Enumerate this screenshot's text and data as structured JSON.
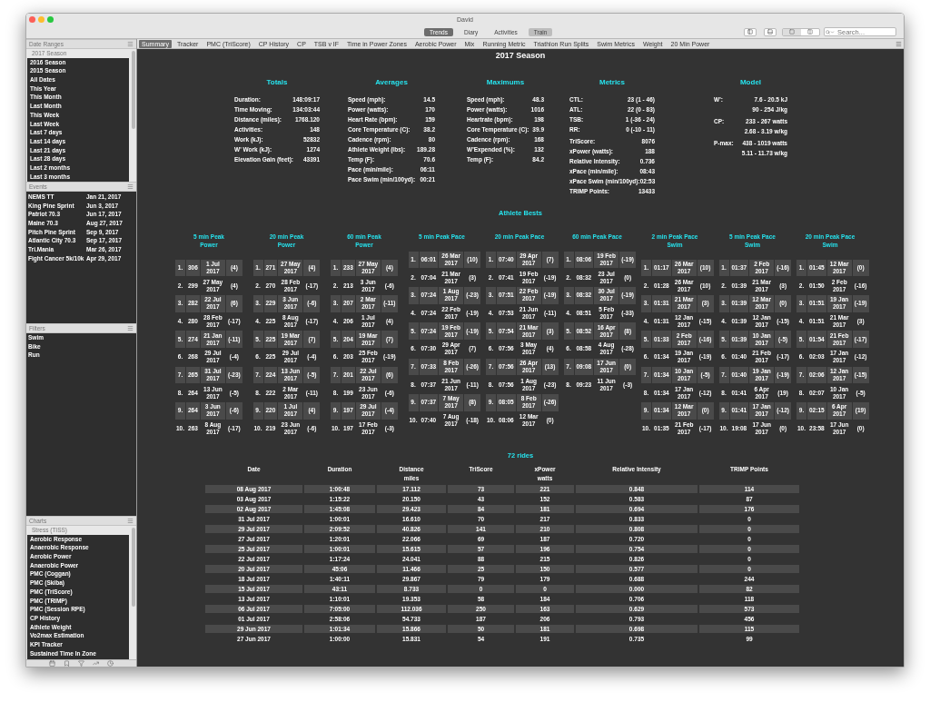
{
  "window": {
    "title": "David"
  },
  "views": [
    {
      "label": "Trends",
      "selected": true,
      "disabled": false
    },
    {
      "label": "Diary",
      "selected": false,
      "disabled": false
    },
    {
      "label": "Activities",
      "selected": false,
      "disabled": false
    },
    {
      "label": "Train",
      "selected": false,
      "disabled": true
    }
  ],
  "search": {
    "placeholder": "Search..."
  },
  "sidebar": {
    "date_ranges": {
      "title": "Date Ranges",
      "items": [
        {
          "label": "2017 Season",
          "selected": true
        },
        {
          "label": "2016 Season",
          "selected": false
        },
        {
          "label": "2015 Season",
          "selected": false
        },
        {
          "label": "All Dates",
          "selected": false
        },
        {
          "label": "This Year",
          "selected": false
        },
        {
          "label": "This Month",
          "selected": false
        },
        {
          "label": "Last Month",
          "selected": false
        },
        {
          "label": "This Week",
          "selected": false
        },
        {
          "label": "Last Week",
          "selected": false
        },
        {
          "label": "Last 7 days",
          "selected": false
        },
        {
          "label": "Last 14 days",
          "selected": false
        },
        {
          "label": "Last 21 days",
          "selected": false
        },
        {
          "label": "Last 28 days",
          "selected": false
        },
        {
          "label": "Last 2 months",
          "selected": false
        },
        {
          "label": "Last 3 months",
          "selected": false
        }
      ]
    },
    "events": {
      "title": "Events",
      "items": [
        {
          "name": "NEMS TT",
          "date": "Jan 21, 2017"
        },
        {
          "name": "King Pine Sprint",
          "date": "Jun 3, 2017"
        },
        {
          "name": "Patriot 70.3",
          "date": "Jun 17, 2017"
        },
        {
          "name": "Maine 70.3",
          "date": "Aug 27, 2017"
        },
        {
          "name": "Pitch Pine Sprint",
          "date": "Sep 9, 2017"
        },
        {
          "name": "Atlantic City 70.3",
          "date": "Sep 17, 2017"
        },
        {
          "name": "Tri.Mania",
          "date": "Mar 26, 2017"
        },
        {
          "name": "Fight Cancer 5k/10k",
          "date": "Apr 29, 2017"
        }
      ]
    },
    "filters": {
      "title": "Filters",
      "items": [
        "Swim",
        "Bike",
        "Run"
      ]
    },
    "charts": {
      "title": "Charts",
      "items": [
        {
          "label": "Stress (TISS)",
          "selected": true
        },
        {
          "label": "Aerobic Response",
          "selected": false
        },
        {
          "label": "Anaerobic Response",
          "selected": false
        },
        {
          "label": "Aerobic Power",
          "selected": false
        },
        {
          "label": "Anaerobic Power",
          "selected": false
        },
        {
          "label": "PMC (Coggan)",
          "selected": false
        },
        {
          "label": "PMC (Skiba)",
          "selected": false
        },
        {
          "label": "PMC (TriScore)",
          "selected": false
        },
        {
          "label": "PMC (TRIMP)",
          "selected": false
        },
        {
          "label": "PMC (Session RPE)",
          "selected": false
        },
        {
          "label": "CP History",
          "selected": false
        },
        {
          "label": "Athlete Weight",
          "selected": false
        },
        {
          "label": "Vo2max Estimation",
          "selected": false
        },
        {
          "label": "KPI Tracker",
          "selected": false
        },
        {
          "label": "Sustained Time In Zone",
          "selected": false
        }
      ]
    }
  },
  "chart_tabs": [
    {
      "label": "Summary",
      "selected": true
    },
    {
      "label": "Tracker",
      "selected": false
    },
    {
      "label": "PMC (TriScore)",
      "selected": false
    },
    {
      "label": "CP History",
      "selected": false
    },
    {
      "label": "CP",
      "selected": false
    },
    {
      "label": "TSB v IF",
      "selected": false
    },
    {
      "label": "Time in Power Zones",
      "selected": false
    },
    {
      "label": "Aerobic Power",
      "selected": false
    },
    {
      "label": "Mix",
      "selected": false
    },
    {
      "label": "Running Metric",
      "selected": false
    },
    {
      "label": "Triathlon Run Splits",
      "selected": false
    },
    {
      "label": "Swim Metrics",
      "selected": false
    },
    {
      "label": "Weight",
      "selected": false
    },
    {
      "label": "20 Min Power",
      "selected": false
    }
  ],
  "summary": {
    "title": "2017 Season",
    "sections": [
      {
        "title": "Totals",
        "groups": [
          [
            {
              "label": "Duration:",
              "values": [
                "148:09:17"
              ]
            },
            {
              "label": "Time Moving:",
              "values": [
                "134:03:44"
              ]
            },
            {
              "label": "Distance (miles):",
              "values": [
                "1768.120"
              ]
            },
            {
              "label": "Activities:",
              "values": [
                "148"
              ]
            },
            {
              "label": "Work (kJ):",
              "values": [
                "52832"
              ]
            },
            {
              "label": "W' Work (kJ):",
              "values": [
                "1274"
              ]
            },
            {
              "label": "Elevation Gain (feet):",
              "values": [
                "43391"
              ]
            }
          ]
        ]
      },
      {
        "title": "Averages",
        "groups": [
          [
            {
              "label": "Speed (mph):",
              "values": [
                "14.5"
              ]
            },
            {
              "label": "Power (watts):",
              "values": [
                "170"
              ]
            },
            {
              "label": "Heart Rate (bpm):",
              "values": [
                "159"
              ]
            },
            {
              "label": "Core Temperature (C):",
              "values": [
                "38.2"
              ]
            },
            {
              "label": "Cadence (rpm):",
              "values": [
                "80"
              ]
            },
            {
              "label": "Athlete Weight (lbs):",
              "values": [
                "189.28"
              ]
            },
            {
              "label": "Temp (F):",
              "values": [
                "70.6"
              ]
            },
            {
              "label": "Pace (min/mile):",
              "values": [
                "06:11"
              ]
            },
            {
              "label": "Pace Swim (min/100yd):",
              "values": [
                "00:21"
              ]
            }
          ]
        ]
      },
      {
        "title": "Maximums",
        "groups": [
          [
            {
              "label": "Speed (mph):",
              "values": [
                "48.3"
              ]
            },
            {
              "label": "Power (watts):",
              "values": [
                "1016"
              ]
            },
            {
              "label": "Heartrate (bpm):",
              "values": [
                "198"
              ]
            },
            {
              "label": "Core Temperature (C):",
              "values": [
                "39.9"
              ]
            },
            {
              "label": "Cadence (rpm):",
              "values": [
                "168"
              ]
            },
            {
              "label": "W'Expended (%):",
              "values": [
                "132"
              ]
            },
            {
              "label": "Temp (F):",
              "values": [
                "84.2"
              ]
            }
          ]
        ]
      },
      {
        "title": "Metrics",
        "groups": [
          [
            {
              "label": "CTL:",
              "values": [
                "23 (1 - 46)"
              ]
            },
            {
              "label": "ATL:",
              "values": [
                "22 (0 - 83)"
              ]
            },
            {
              "label": "TSB:",
              "values": [
                "1 (-36 - 24)"
              ]
            },
            {
              "label": "RR:",
              "values": [
                "0 (-10 - 11)"
              ]
            }
          ],
          [
            {
              "label": "TriScore:",
              "values": [
                "8076"
              ]
            },
            {
              "label": "xPower (watts):",
              "values": [
                "188"
              ]
            },
            {
              "label": "Relative Intensity:",
              "values": [
                "0.736"
              ]
            },
            {
              "label": "xPace (min/mile):",
              "values": [
                "08:43"
              ]
            },
            {
              "label": "xPace Swim (min/100yd):",
              "values": [
                "02:53"
              ]
            },
            {
              "label": "TRIMP Points:",
              "values": [
                "13433"
              ]
            }
          ]
        ]
      },
      {
        "title": "Model",
        "groups": [
          [
            {
              "label": "W':",
              "values": [
                "7.6 - 20.5 kJ",
                "90 - 254 J/kg"
              ]
            }
          ],
          [
            {
              "label": "CP:",
              "values": [
                "233 - 267 watts",
                "2.68 - 3.19 w/kg"
              ]
            }
          ],
          [
            {
              "label": "P-max:",
              "values": [
                "438 - 1019 watts",
                "5.11 - 11.73 w/kg"
              ]
            }
          ]
        ]
      }
    ]
  },
  "athlete_bests": {
    "title": "Athlete Bests",
    "columns": [
      {
        "title": [
          "5 min Peak",
          "Power"
        ],
        "rows": [
          {
            "rank": "1.",
            "value": "306",
            "day": "1 Jul",
            "year": "2017",
            "change": "(4)"
          },
          {
            "rank": "2.",
            "value": "299",
            "day": "27 May",
            "year": "2017",
            "change": "(4)"
          },
          {
            "rank": "3.",
            "value": "282",
            "day": "22 Jul",
            "year": "2017",
            "change": "(6)"
          },
          {
            "rank": "4.",
            "value": "280",
            "day": "28 Feb",
            "year": "2017",
            "change": "(-17)"
          },
          {
            "rank": "5.",
            "value": "274",
            "day": "21 Jan",
            "year": "2017",
            "change": "(-11)"
          },
          {
            "rank": "6.",
            "value": "268",
            "day": "29 Jul",
            "year": "2017",
            "change": "(-4)"
          },
          {
            "rank": "7.",
            "value": "265",
            "day": "31 Jul",
            "year": "2017",
            "change": "(-23)"
          },
          {
            "rank": "8.",
            "value": "264",
            "day": "13 Jun",
            "year": "2017",
            "change": "(-5)"
          },
          {
            "rank": "9.",
            "value": "264",
            "day": "3 Jun",
            "year": "2017",
            "change": "(-6)"
          },
          {
            "rank": "10.",
            "value": "263",
            "day": "8 Aug",
            "year": "2017",
            "change": "(-17)"
          }
        ]
      },
      {
        "title": [
          "20 min Peak",
          "Power"
        ],
        "rows": [
          {
            "rank": "1.",
            "value": "271",
            "day": "27 May",
            "year": "2017",
            "change": "(4)"
          },
          {
            "rank": "2.",
            "value": "270",
            "day": "28 Feb",
            "year": "2017",
            "change": "(-17)"
          },
          {
            "rank": "3.",
            "value": "229",
            "day": "3 Jun",
            "year": "2017",
            "change": "(-6)"
          },
          {
            "rank": "4.",
            "value": "225",
            "day": "8 Aug",
            "year": "2017",
            "change": "(-17)"
          },
          {
            "rank": "5.",
            "value": "225",
            "day": "19 Mar",
            "year": "2017",
            "change": "(7)"
          },
          {
            "rank": "6.",
            "value": "225",
            "day": "29 Jul",
            "year": "2017",
            "change": "(-4)"
          },
          {
            "rank": "7.",
            "value": "224",
            "day": "13 Jun",
            "year": "2017",
            "change": "(-5)"
          },
          {
            "rank": "8.",
            "value": "222",
            "day": "2 Mar",
            "year": "2017",
            "change": "(-11)"
          },
          {
            "rank": "9.",
            "value": "220",
            "day": "1 Jul",
            "year": "2017",
            "change": "(4)"
          },
          {
            "rank": "10.",
            "value": "219",
            "day": "23 Jun",
            "year": "2017",
            "change": "(-6)"
          }
        ]
      },
      {
        "title": [
          "60 min Peak",
          "Power"
        ],
        "rows": [
          {
            "rank": "1.",
            "value": "233",
            "day": "27 May",
            "year": "2017",
            "change": "(4)"
          },
          {
            "rank": "2.",
            "value": "213",
            "day": "3 Jun",
            "year": "2017",
            "change": "(-6)"
          },
          {
            "rank": "3.",
            "value": "207",
            "day": "2 Mar",
            "year": "2017",
            "change": "(-11)"
          },
          {
            "rank": "4.",
            "value": "206",
            "day": "1 Jul",
            "year": "2017",
            "change": "(4)"
          },
          {
            "rank": "5.",
            "value": "204",
            "day": "19 Mar",
            "year": "2017",
            "change": "(7)"
          },
          {
            "rank": "6.",
            "value": "203",
            "day": "25 Feb",
            "year": "2017",
            "change": "(-19)"
          },
          {
            "rank": "7.",
            "value": "201",
            "day": "22 Jul",
            "year": "2017",
            "change": "(6)"
          },
          {
            "rank": "8.",
            "value": "199",
            "day": "23 Jun",
            "year": "2017",
            "change": "(-6)"
          },
          {
            "rank": "9.",
            "value": "197",
            "day": "29 Jul",
            "year": "2017",
            "change": "(-4)"
          },
          {
            "rank": "10.",
            "value": "197",
            "day": "17 Feb",
            "year": "2017",
            "change": "(-3)"
          }
        ]
      },
      {
        "title": [
          "5 min Peak Pace"
        ],
        "rows": [
          {
            "rank": "1.",
            "value": "06:01",
            "day": "26 Mar",
            "year": "2017",
            "change": "(10)"
          },
          {
            "rank": "2.",
            "value": "07:04",
            "day": "21 Mar",
            "year": "2017",
            "change": "(3)"
          },
          {
            "rank": "3.",
            "value": "07:24",
            "day": "1 Aug",
            "year": "2017",
            "change": "(-23)"
          },
          {
            "rank": "4.",
            "value": "07:24",
            "day": "22 Feb",
            "year": "2017",
            "change": "(-19)"
          },
          {
            "rank": "5.",
            "value": "07:24",
            "day": "19 Feb",
            "year": "2017",
            "change": "(-19)"
          },
          {
            "rank": "6.",
            "value": "07:30",
            "day": "29 Apr",
            "year": "2017",
            "change": "(7)"
          },
          {
            "rank": "7.",
            "value": "07:33",
            "day": "8 Feb",
            "year": "2017",
            "change": "(-26)"
          },
          {
            "rank": "8.",
            "value": "07:37",
            "day": "21 Jun",
            "year": "2017",
            "change": "(-11)"
          },
          {
            "rank": "9.",
            "value": "07:37",
            "day": "7 May",
            "year": "2017",
            "change": "(8)"
          },
          {
            "rank": "10.",
            "value": "07:40",
            "day": "7 Aug",
            "year": "2017",
            "change": "(-18)"
          }
        ]
      },
      {
        "title": [
          "20 min Peak Pace"
        ],
        "rows": [
          {
            "rank": "1.",
            "value": "07:40",
            "day": "29 Apr",
            "year": "2017",
            "change": "(7)"
          },
          {
            "rank": "2.",
            "value": "07:41",
            "day": "19 Feb",
            "year": "2017",
            "change": "(-19)"
          },
          {
            "rank": "3.",
            "value": "07:51",
            "day": "22 Feb",
            "year": "2017",
            "change": "(-19)"
          },
          {
            "rank": "4.",
            "value": "07:53",
            "day": "21 Jun",
            "year": "2017",
            "change": "(-11)"
          },
          {
            "rank": "5.",
            "value": "07:54",
            "day": "21 Mar",
            "year": "2017",
            "change": "(3)"
          },
          {
            "rank": "6.",
            "value": "07:56",
            "day": "3 May",
            "year": "2017",
            "change": "(4)"
          },
          {
            "rank": "7.",
            "value": "07:56",
            "day": "26 Apr",
            "year": "2017",
            "change": "(13)"
          },
          {
            "rank": "8.",
            "value": "07:56",
            "day": "1 Aug",
            "year": "2017",
            "change": "(-23)"
          },
          {
            "rank": "9.",
            "value": "08:05",
            "day": "8 Feb",
            "year": "2017",
            "change": "(-26)"
          },
          {
            "rank": "10.",
            "value": "08:06",
            "day": "12 Mar",
            "year": "2017",
            "change": "(0)"
          }
        ]
      },
      {
        "title": [
          "60 min Peak Pace"
        ],
        "rows": [
          {
            "rank": "1.",
            "value": "08:06",
            "day": "19 Feb",
            "year": "2017",
            "change": "(-19)"
          },
          {
            "rank": "2.",
            "value": "08:32",
            "day": "23 Jul",
            "year": "2017",
            "change": "(0)"
          },
          {
            "rank": "3.",
            "value": "08:32",
            "day": "30 Jul",
            "year": "2017",
            "change": "(-19)"
          },
          {
            "rank": "4.",
            "value": "08:51",
            "day": "5 Feb",
            "year": "2017",
            "change": "(-33)"
          },
          {
            "rank": "5.",
            "value": "08:52",
            "day": "16 Apr",
            "year": "2017",
            "change": "(8)"
          },
          {
            "rank": "6.",
            "value": "08:58",
            "day": "4 Aug",
            "year": "2017",
            "change": "(-28)"
          },
          {
            "rank": "7.",
            "value": "09:08",
            "day": "17 Jun",
            "year": "2017",
            "change": "(0)"
          },
          {
            "rank": "8.",
            "value": "09:23",
            "day": "11 Jun",
            "year": "2017",
            "change": "(-3)"
          }
        ]
      },
      {
        "title": [
          "2 min Peak Pace",
          "Swim"
        ],
        "rows": [
          {
            "rank": "1.",
            "value": "01:17",
            "day": "26 Mar",
            "year": "2017",
            "change": "(10)"
          },
          {
            "rank": "2.",
            "value": "01:28",
            "day": "26 Mar",
            "year": "2017",
            "change": "(10)"
          },
          {
            "rank": "3.",
            "value": "01:31",
            "day": "21 Mar",
            "year": "2017",
            "change": "(3)"
          },
          {
            "rank": "4.",
            "value": "01:31",
            "day": "12 Jan",
            "year": "2017",
            "change": "(-15)"
          },
          {
            "rank": "5.",
            "value": "01:33",
            "day": "2 Feb",
            "year": "2017",
            "change": "(-16)"
          },
          {
            "rank": "6.",
            "value": "01:34",
            "day": "19 Jan",
            "year": "2017",
            "change": "(-19)"
          },
          {
            "rank": "7.",
            "value": "01:34",
            "day": "10 Jan",
            "year": "2017",
            "change": "(-5)"
          },
          {
            "rank": "8.",
            "value": "01:34",
            "day": "17 Jan",
            "year": "2017",
            "change": "(-12)"
          },
          {
            "rank": "9.",
            "value": "01:34",
            "day": "12 Mar",
            "year": "2017",
            "change": "(0)"
          },
          {
            "rank": "10.",
            "value": "01:35",
            "day": "21 Feb",
            "year": "2017",
            "change": "(-17)"
          }
        ]
      },
      {
        "title": [
          "5 min Peak Pace",
          "Swim"
        ],
        "rows": [
          {
            "rank": "1.",
            "value": "01:37",
            "day": "2 Feb",
            "year": "2017",
            "change": "(-16)"
          },
          {
            "rank": "2.",
            "value": "01:39",
            "day": "21 Mar",
            "year": "2017",
            "change": "(3)"
          },
          {
            "rank": "3.",
            "value": "01:39",
            "day": "12 Mar",
            "year": "2017",
            "change": "(0)"
          },
          {
            "rank": "4.",
            "value": "01:39",
            "day": "12 Jan",
            "year": "2017",
            "change": "(-15)"
          },
          {
            "rank": "5.",
            "value": "01:39",
            "day": "10 Jan",
            "year": "2017",
            "change": "(-5)"
          },
          {
            "rank": "6.",
            "value": "01:40",
            "day": "21 Feb",
            "year": "2017",
            "change": "(-17)"
          },
          {
            "rank": "7.",
            "value": "01:40",
            "day": "19 Jan",
            "year": "2017",
            "change": "(-19)"
          },
          {
            "rank": "8.",
            "value": "01:41",
            "day": "6 Apr",
            "year": "2017",
            "change": "(19)"
          },
          {
            "rank": "9.",
            "value": "01:41",
            "day": "17 Jan",
            "year": "2017",
            "change": "(-12)"
          },
          {
            "rank": "10.",
            "value": "19:08",
            "day": "17 Jun",
            "year": "2017",
            "change": "(0)"
          }
        ]
      },
      {
        "title": [
          "20 min Peak Pace",
          "Swim"
        ],
        "rows": [
          {
            "rank": "1.",
            "value": "01:45",
            "day": "12 Mar",
            "year": "2017",
            "change": "(0)"
          },
          {
            "rank": "2.",
            "value": "01:50",
            "day": "2 Feb",
            "year": "2017",
            "change": "(-16)"
          },
          {
            "rank": "3.",
            "value": "01:51",
            "day": "19 Jan",
            "year": "2017",
            "change": "(-19)"
          },
          {
            "rank": "4.",
            "value": "01:51",
            "day": "21 Mar",
            "year": "2017",
            "change": "(3)"
          },
          {
            "rank": "5.",
            "value": "01:54",
            "day": "21 Feb",
            "year": "2017",
            "change": "(-17)"
          },
          {
            "rank": "6.",
            "value": "02:03",
            "day": "17 Jan",
            "year": "2017",
            "change": "(-12)"
          },
          {
            "rank": "7.",
            "value": "02:06",
            "day": "12 Jan",
            "year": "2017",
            "change": "(-15)"
          },
          {
            "rank": "8.",
            "value": "02:07",
            "day": "10 Jan",
            "year": "2017",
            "change": "(-5)"
          },
          {
            "rank": "9.",
            "value": "02:15",
            "day": "6 Apr",
            "year": "2017",
            "change": "(19)"
          },
          {
            "rank": "10.",
            "value": "23:58",
            "day": "17 Jun",
            "year": "2017",
            "change": "(0)"
          }
        ]
      }
    ]
  },
  "rides": {
    "title": "72 rides",
    "columns": [
      {
        "label": "Date"
      },
      {
        "label": "Duration"
      },
      {
        "label": "Distance",
        "unit": "miles"
      },
      {
        "label": "TriScore"
      },
      {
        "label": "xPower",
        "unit": "watts"
      },
      {
        "label": "Relative Intensity"
      },
      {
        "label": "TRIMP Points"
      }
    ],
    "rows": [
      [
        "08 Aug 2017",
        "1:00:48",
        "17.112",
        "73",
        "221",
        "0.848",
        "114"
      ],
      [
        "03 Aug 2017",
        "1:15:22",
        "20.150",
        "43",
        "152",
        "0.583",
        "87"
      ],
      [
        "02 Aug 2017",
        "1:45:08",
        "29.423",
        "84",
        "181",
        "0.694",
        "176"
      ],
      [
        "31 Jul 2017",
        "1:00:01",
        "16.610",
        "70",
        "217",
        "0.833",
        "0"
      ],
      [
        "29 Jul 2017",
        "2:09:52",
        "40.826",
        "141",
        "210",
        "0.808",
        "0"
      ],
      [
        "27 Jul 2017",
        "1:20:01",
        "22.066",
        "69",
        "187",
        "0.720",
        "0"
      ],
      [
        "25 Jul 2017",
        "1:00:01",
        "15.615",
        "57",
        "196",
        "0.754",
        "0"
      ],
      [
        "22 Jul 2017",
        "1:17:24",
        "24.041",
        "88",
        "215",
        "0.826",
        "0"
      ],
      [
        "20 Jul 2017",
        "45:06",
        "11.466",
        "25",
        "150",
        "0.577",
        "0"
      ],
      [
        "18 Jul 2017",
        "1:40:11",
        "29.867",
        "79",
        "179",
        "0.688",
        "244"
      ],
      [
        "15 Jul 2017",
        "43:11",
        "8.733",
        "0",
        "0",
        "0.000",
        "82"
      ],
      [
        "13 Jul 2017",
        "1:10:01",
        "19.353",
        "58",
        "184",
        "0.706",
        "118"
      ],
      [
        "06 Jul 2017",
        "7:05:00",
        "112.036",
        "250",
        "163",
        "0.629",
        "573"
      ],
      [
        "01 Jul 2017",
        "2:58:06",
        "54.733",
        "187",
        "206",
        "0.793",
        "456"
      ],
      [
        "29 Jun 2017",
        "1:01:34",
        "15.866",
        "50",
        "181",
        "0.698",
        "115"
      ],
      [
        "27 Jun 2017",
        "1:00:00",
        "15.831",
        "54",
        "191",
        "0.735",
        "99"
      ]
    ]
  }
}
